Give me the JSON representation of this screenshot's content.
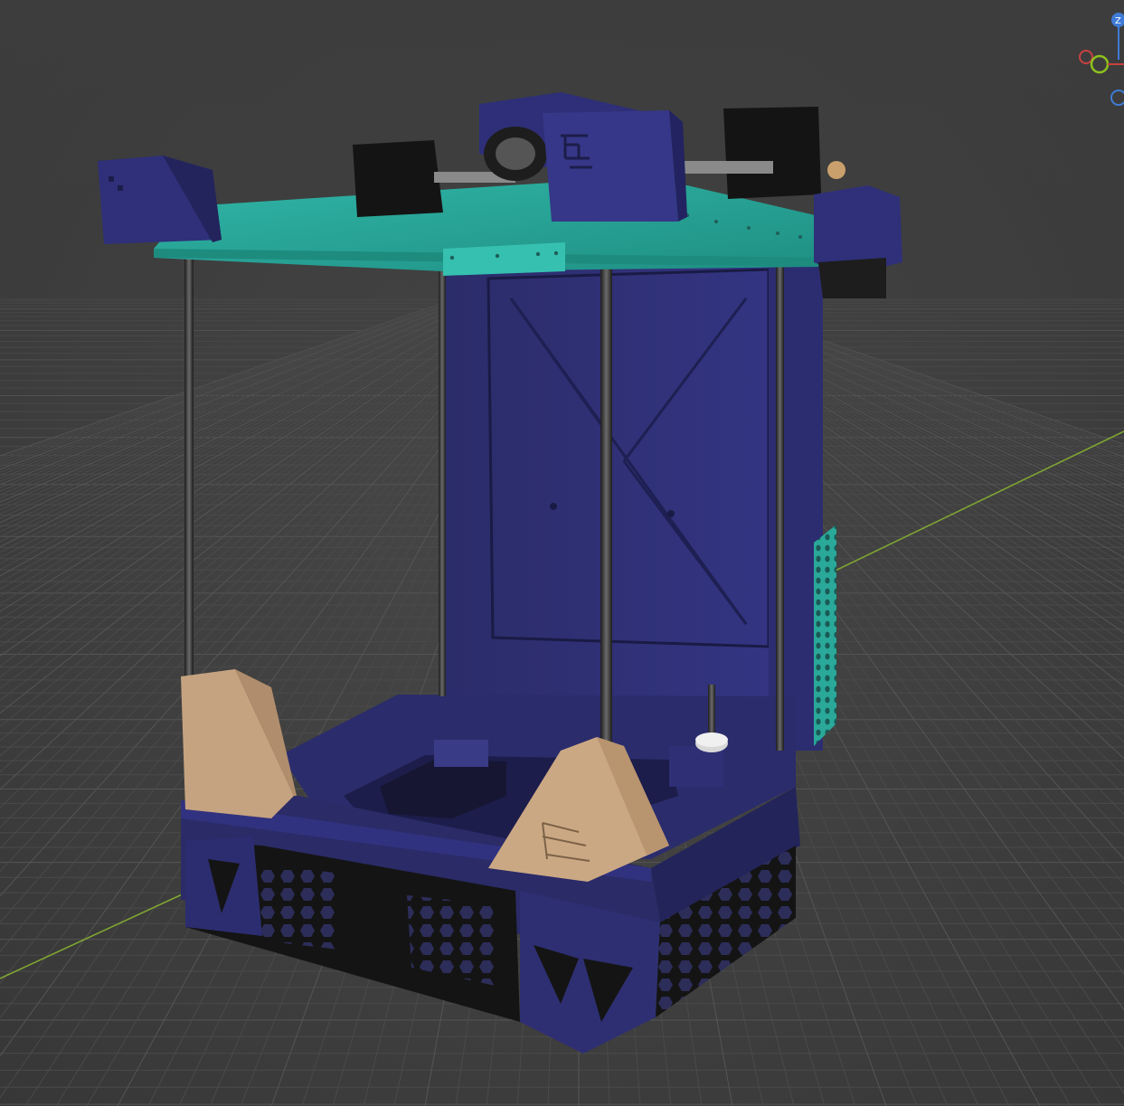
{
  "app": {
    "view": "3D viewport"
  },
  "gizmo": {
    "z_label": "Z",
    "colors": {
      "x": "#c94040",
      "y": "#8ec21d",
      "z": "#3f7bd6"
    }
  },
  "model": {
    "name": "",
    "colors": {
      "frame": "#2e2f6e",
      "frame_light": "#3a3b86",
      "frame_dark": "#22234f",
      "top_plate": "#2aa89a",
      "top_plate_light": "#3bbcae",
      "feet": "#c2a07e",
      "black": "#151515",
      "rods": "#3b3b3b"
    },
    "icons": [
      "viewport-grid",
      "y-axis-line",
      "printer-model",
      "view-gizmo"
    ]
  }
}
